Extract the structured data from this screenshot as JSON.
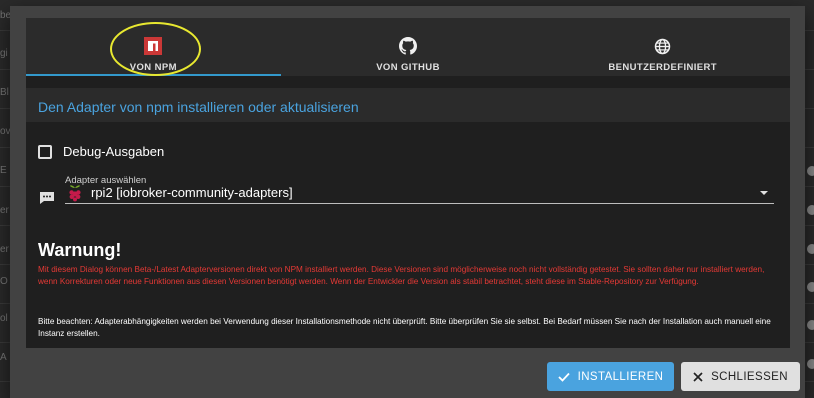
{
  "background": {
    "fragments": [
      "be",
      "gi",
      "Bl",
      "ov",
      "E",
      "er",
      "er",
      "O",
      "ol",
      "A"
    ]
  },
  "tabs": [
    {
      "label": "VON NPM",
      "icon": "npm-icon",
      "active": true
    },
    {
      "label": "VON GITHUB",
      "icon": "github-icon",
      "active": false
    },
    {
      "label": "BENUTZERDEFINIERT",
      "icon": "globe-icon",
      "active": false
    }
  ],
  "dialog_title": "Den Adapter von npm installieren oder aktualisieren",
  "debug_checkbox": {
    "label": "Debug-Ausgaben",
    "checked": false
  },
  "adapter_select": {
    "caption": "Adapter auswählen",
    "value": "rpi2 [iobroker-community-adapters]",
    "icon": "raspberry-pi-icon"
  },
  "warning": {
    "title": "Warnung!",
    "text": "Mit diesem Dialog können Beta-/Latest Adapterversionen direkt von NPM installiert werden. Diese Versionen sind möglicherweise noch nicht vollständig getestet. Sie sollten daher nur installiert werden, wenn Korrekturen oder neue Funktionen aus diesen Versionen benötigt werden. Wenn der Entwickler die Version als stabil betrachtet, steht diese im Stable-Repository zur Verfügung.",
    "note": "Bitte beachten: Adapterabhängigkeiten werden bei Verwendung dieser Installationsmethode nicht überprüft. Bitte überprüfen Sie sie selbst. Bei Bedarf müssen Sie nach der Installation auch manuell eine Instanz erstellen."
  },
  "buttons": {
    "install": "INSTALLIEREN",
    "close": "SCHLIESSEN"
  },
  "colors": {
    "accent": "#4aa3df",
    "warning": "#e53935",
    "highlight": "#e8e830"
  }
}
